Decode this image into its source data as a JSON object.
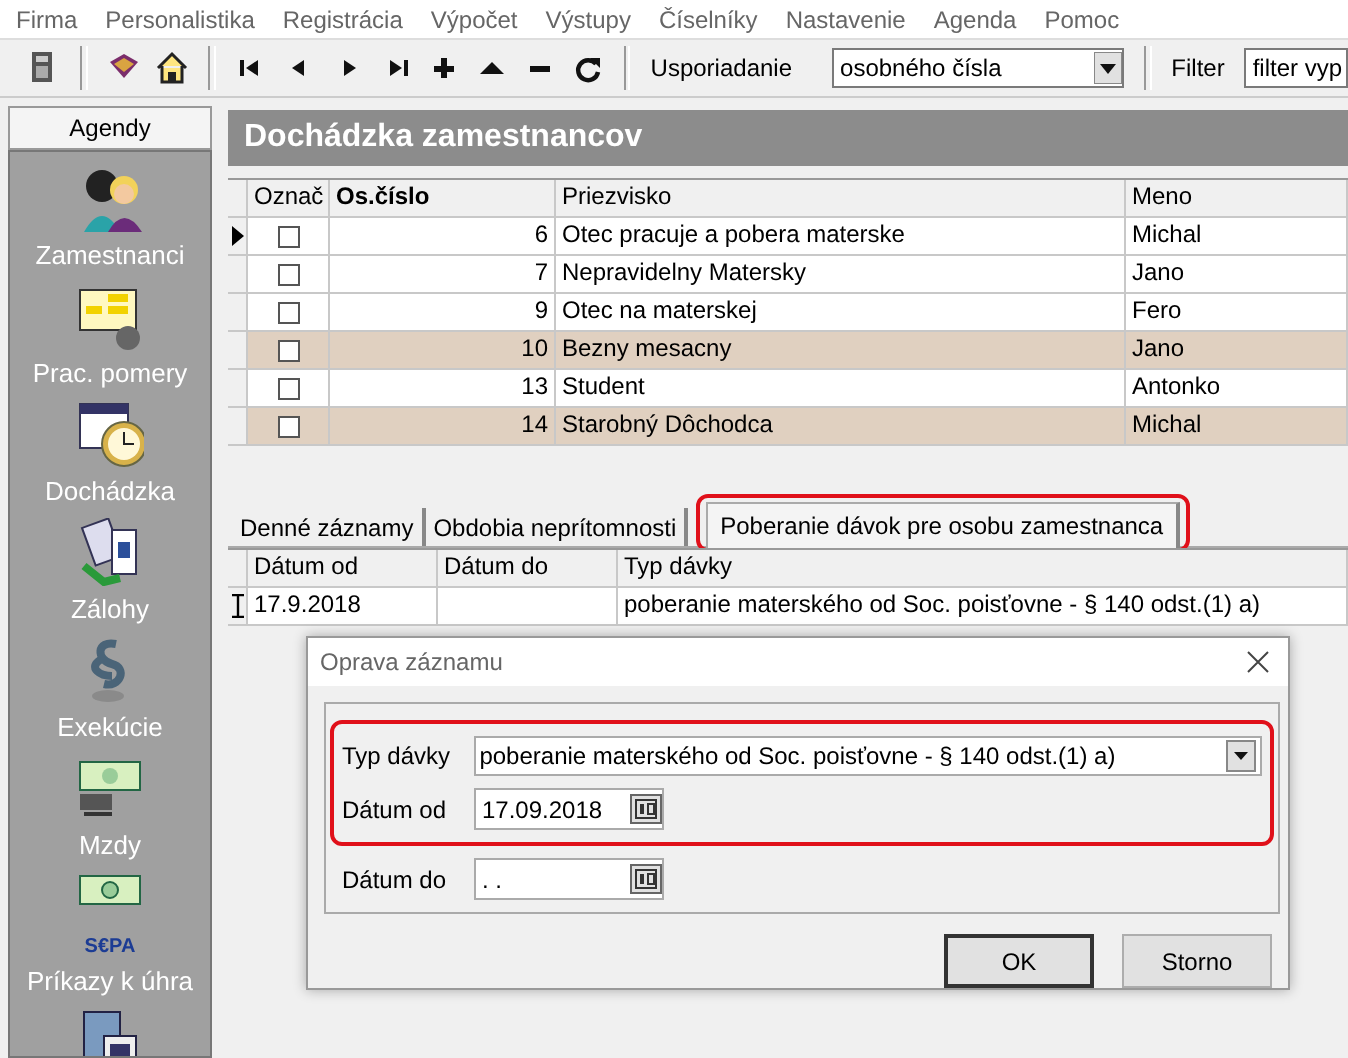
{
  "menu": [
    "Firma",
    "Personalistika",
    "Registrácia",
    "Výpočet",
    "Výstupy",
    "Číselníky",
    "Nastavenie",
    "Agenda",
    "Pomoc"
  ],
  "toolbar": {
    "sort_label": "Usporiadanie",
    "sort_value": "osobného čísla",
    "filter_label": "Filter",
    "filter_value": "filter vyp"
  },
  "sidebar": {
    "header": "Agendy",
    "items": [
      {
        "label": "Zamestnanci",
        "kind": "people"
      },
      {
        "label": "Prac. pomery",
        "kind": "chart"
      },
      {
        "label": "Dochádzka",
        "kind": "clock"
      },
      {
        "label": "Zálohy",
        "kind": "cash"
      },
      {
        "label": "Exekúcie",
        "kind": "paragraph"
      },
      {
        "label": "Mzdy",
        "kind": "notes"
      },
      {
        "label": "Príkazy k úhra",
        "kind": "sepa",
        "badge": "S€PA"
      },
      {
        "kind": "building"
      }
    ]
  },
  "title": "Dochádzka zamestnancov",
  "grid": {
    "columns": [
      "Označ",
      "Os.číslo",
      "Priezvisko",
      "Meno"
    ],
    "rows": [
      {
        "current": true,
        "checked": false,
        "highlighted": false,
        "cells": [
          "",
          "6",
          "Otec pracuje a pobera materske",
          "Michal"
        ]
      },
      {
        "current": false,
        "checked": false,
        "highlighted": false,
        "cells": [
          "",
          "7",
          "Nepravidelny Matersky",
          "Jano"
        ]
      },
      {
        "current": false,
        "checked": false,
        "highlighted": false,
        "cells": [
          "",
          "9",
          "Otec na materskej",
          "Fero"
        ]
      },
      {
        "current": false,
        "checked": false,
        "highlighted": true,
        "cells": [
          "",
          "10",
          "Bezny mesacny",
          "Jano"
        ]
      },
      {
        "current": false,
        "checked": false,
        "highlighted": false,
        "cells": [
          "",
          "13",
          "Student",
          "Antonko"
        ]
      },
      {
        "current": false,
        "checked": false,
        "highlighted": true,
        "cells": [
          "",
          "14",
          "Starobný  Dôchodca",
          "Michal"
        ]
      }
    ]
  },
  "tabs": [
    {
      "label": "Denné záznamy",
      "selected": false,
      "outlined": false
    },
    {
      "label": "Obdobia neprítomnosti",
      "selected": false,
      "outlined": false
    },
    {
      "label": "Poberanie dávok pre osobu zamestnanca",
      "selected": true,
      "outlined": true
    }
  ],
  "subgrid": {
    "columns": [
      "Dátum od",
      "Dátum do",
      "Typ dávky"
    ],
    "rows": [
      {
        "editing": true,
        "cells": [
          "17.9.2018",
          "",
          "poberanie materského od Soc. poisťovne - § 140 odst.(1) a)"
        ]
      }
    ]
  },
  "dialog": {
    "title": "Oprava záznamu",
    "fields": [
      {
        "label": "Typ dávky",
        "kind": "combo",
        "value": "poberanie materského od Soc. poisťovne - § 140 odst.(1) a)",
        "outlined": true
      },
      {
        "label": "Dátum od",
        "kind": "date",
        "value": "17.09.2018",
        "outlined": true
      },
      {
        "label": "Dátum do",
        "kind": "date",
        "value": ". .",
        "outlined": false
      }
    ],
    "buttons": [
      {
        "label": "OK",
        "default": true
      },
      {
        "label": "Storno",
        "default": false
      }
    ]
  }
}
